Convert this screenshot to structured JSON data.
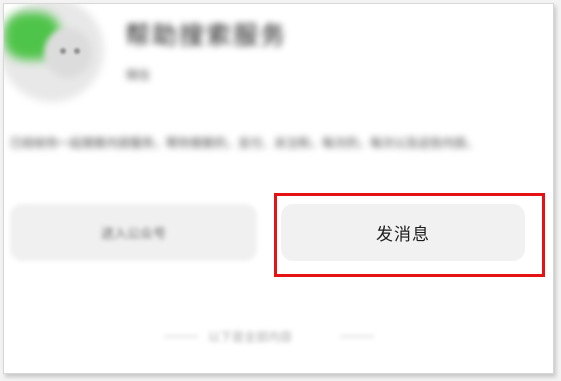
{
  "profile": {
    "avatar_icon": "wechat-avatar-icon",
    "name_blurred": "帮助搜索服务",
    "sub_blurred": "微信"
  },
  "description_blurred": "已经给你一起搜索内容服务，帮你搜索的，支付、关注和，每次的，每次以及这些内容。",
  "actions": {
    "left_button_blurred": "进入公众号",
    "send_message_label": "发消息"
  },
  "footer_blurred": "以下是全部内容",
  "colors": {
    "highlight": "#e41212",
    "avatar_green": "#4fc44a",
    "button_bg": "#f1f1f1"
  }
}
